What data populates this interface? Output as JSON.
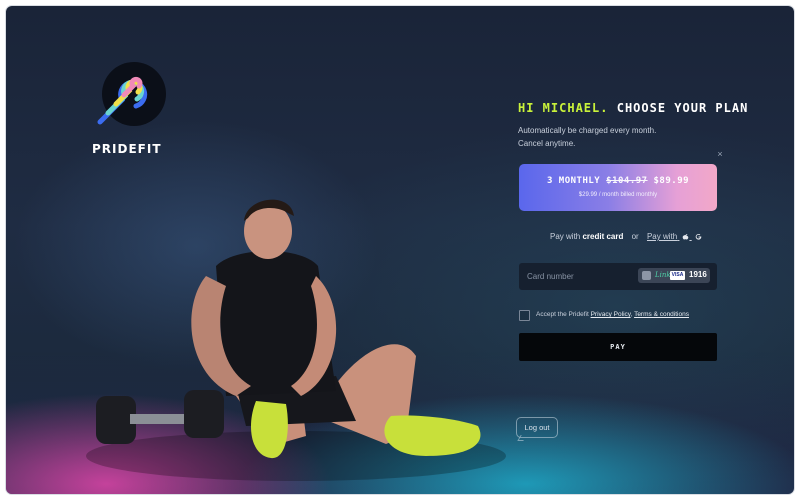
{
  "brand": {
    "name": "PRIDEFIT",
    "logo_icon": "rainbow-p-logo"
  },
  "header": {
    "greeting_name": "HI MICHAEL.",
    "greeting_rest": "CHOOSE YOUR PLAN",
    "subtext_line1": "Automatically be charged every month.",
    "subtext_line2": "Cancel anytime."
  },
  "close_label": "×",
  "plan": {
    "title": "3 MONTHLY",
    "old_price": "$104.97",
    "price": "$89.99",
    "subtitle": "$29.99 / month billed monthly"
  },
  "payment_method": {
    "prefix": "Pay with",
    "credit_label": "credit card",
    "or_label": "or",
    "alt_label": "Pay with",
    "alt_icons": [
      "apple-icon",
      "google-icon"
    ]
  },
  "card": {
    "placeholder": "Card number",
    "brand_text": "Link",
    "network": "VISA",
    "last4": "1916"
  },
  "terms": {
    "prefix": "Accept the Pridefit",
    "privacy_label": "Privacy Policy",
    "separator": ",",
    "terms_label": "Terms & conditions",
    "checked": false
  },
  "pay_button_label": "PAY",
  "logout_label": "Log out",
  "colors": {
    "accent_lime": "#c9f23a",
    "plan_gradient_start": "#5a67ec",
    "plan_gradient_end": "#f2a8c8",
    "pay_button": "#05070a"
  }
}
